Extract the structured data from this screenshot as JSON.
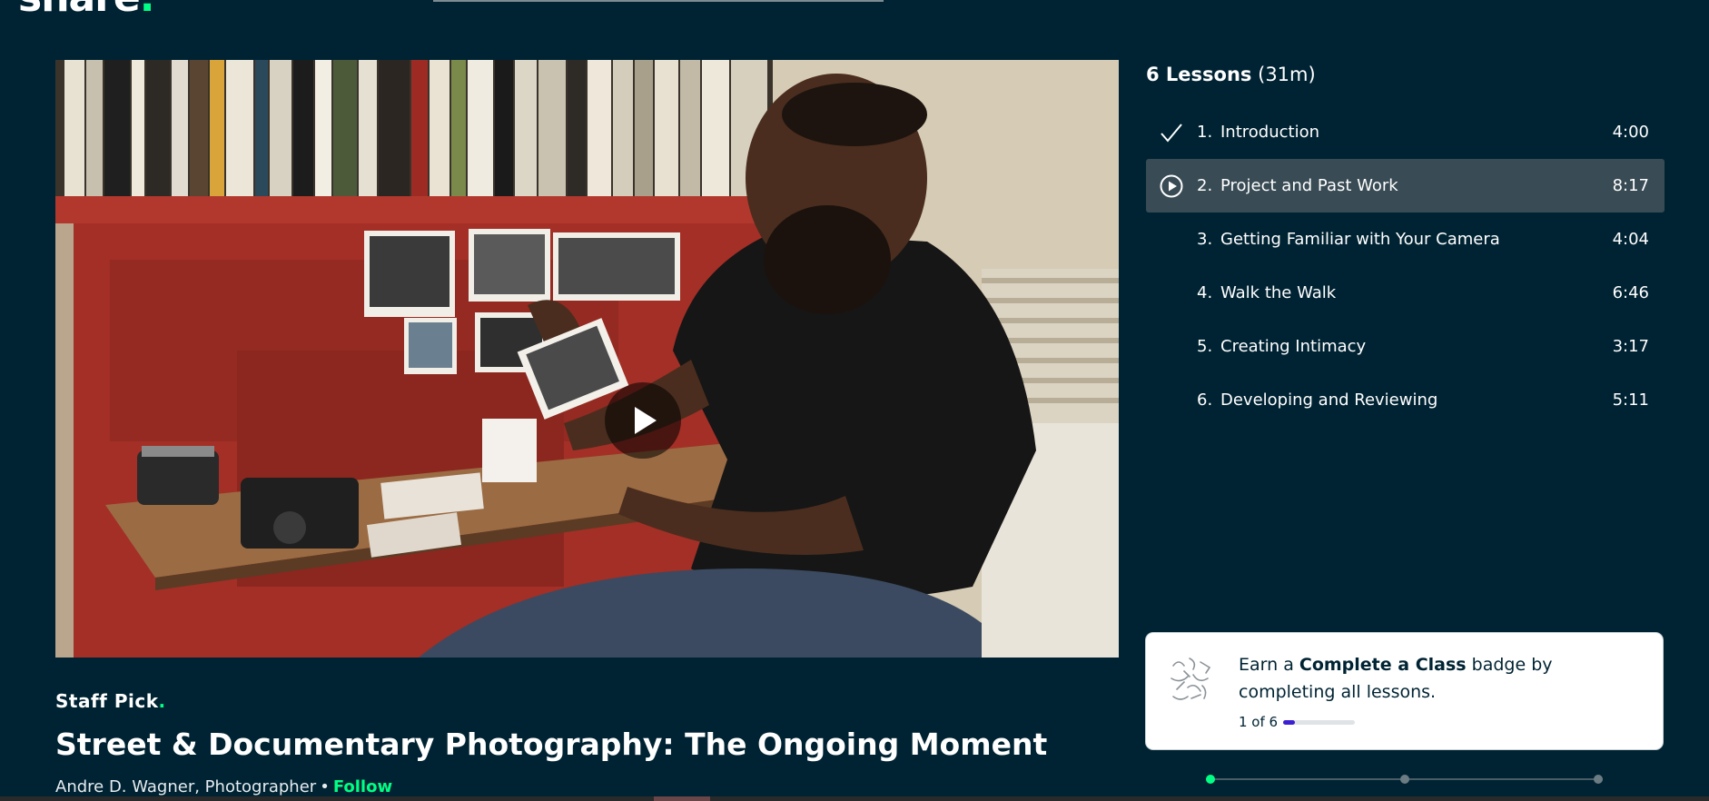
{
  "brand": {
    "logo_text": "share",
    "logo_dot": ".",
    "accent": "#00ff84"
  },
  "video": {
    "play_icon": "play-icon",
    "state": "paused"
  },
  "class_info": {
    "staff_pick": "Staff Pick",
    "staff_pick_dot": ".",
    "title": "Street & Documentary Photography: The Ongoing Moment",
    "teacher": "Andre D. Wagner, Photographer",
    "separator": "•",
    "follow_label": "Follow"
  },
  "lessons": {
    "count_label": "6 Lessons",
    "duration_label": "(31m)",
    "items": [
      {
        "number": "1.",
        "title": "Introduction",
        "duration": "4:00",
        "status_icon": "check-icon"
      },
      {
        "number": "2.",
        "title": "Project and Past Work",
        "duration": "8:17",
        "status_icon": "play-circle-icon"
      },
      {
        "number": "3.",
        "title": "Getting Familiar with Your Camera",
        "duration": "4:04",
        "status_icon": ""
      },
      {
        "number": "4.",
        "title": "Walk the Walk",
        "duration": "6:46",
        "status_icon": ""
      },
      {
        "number": "5.",
        "title": "Creating Intimacy",
        "duration": "3:17",
        "status_icon": ""
      },
      {
        "number": "6.",
        "title": "Developing and Reviewing",
        "duration": "5:11",
        "status_icon": ""
      }
    ],
    "active_index": 1
  },
  "badge": {
    "text_before": "Earn a ",
    "text_bold": "Complete a Class",
    "text_after": " badge by completing all lessons.",
    "progress_label": "1 of 6",
    "progress_fraction": 0.167,
    "progress_color": "#3b1fd1"
  },
  "carousel": {
    "dots": 3,
    "active": 0
  }
}
